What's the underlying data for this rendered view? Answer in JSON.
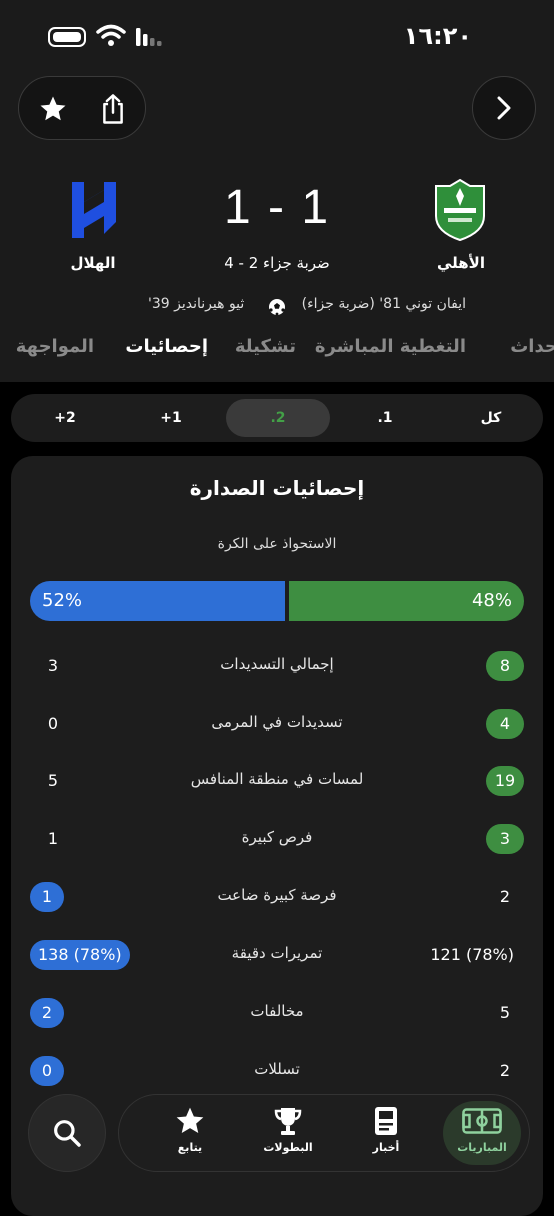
{
  "status_bar": {
    "time": "١٦:٢٠"
  },
  "match": {
    "home_team": "الأهلي",
    "away_team": "الهلال",
    "score": "1 - 1",
    "penalty_note": "ضربة جزاء 2 - 4",
    "scorer_home": "ايفان توني 81' (ضربة جزاء)",
    "scorer_away": "ثيو هيرنانديز 39'"
  },
  "tabs": [
    "أحداث",
    "التغطية المباشرة",
    "تشكيلة",
    "إحصائيات",
    "المواجهة"
  ],
  "filter": [
    "كل",
    ".1",
    ".2",
    "+1",
    "+2"
  ],
  "stats": {
    "title": "إحصائيات الصدارة",
    "possession": {
      "label": "الاستحواذ على الكرة",
      "home": "48%",
      "away": "52%",
      "home_value": 48,
      "away_value": 52
    },
    "rows": [
      {
        "label": "إجمالي التسديدات",
        "home": "8",
        "away": "3"
      },
      {
        "label": "تسديدات في المرمى",
        "home": "4",
        "away": "0"
      },
      {
        "label": "لمسات في منطقة المنافس",
        "home": "19",
        "away": "5"
      },
      {
        "label": "فرص كبيرة",
        "home": "3",
        "away": "1"
      },
      {
        "label": "فرصة كبيرة ضاعت",
        "home": "2",
        "away": "1"
      },
      {
        "label": "تمريرات دقيقة",
        "home": "121 (78%)",
        "away": "138 (78%)"
      },
      {
        "label": "مخالفات",
        "home": "5",
        "away": "2"
      },
      {
        "label": "تسللات",
        "home": "2",
        "away": "0"
      }
    ]
  },
  "bottom_nav": {
    "items": [
      {
        "label": "المباريات",
        "icon": "pitch-icon"
      },
      {
        "label": "أخبار",
        "icon": "news-icon"
      },
      {
        "label": "البطولات",
        "icon": "trophy-icon"
      },
      {
        "label": "يتابع",
        "icon": "star-icon"
      }
    ]
  },
  "colors": {
    "home": "#3e8e41",
    "away": "#2e6fd6",
    "active_filter": "#43a047"
  }
}
